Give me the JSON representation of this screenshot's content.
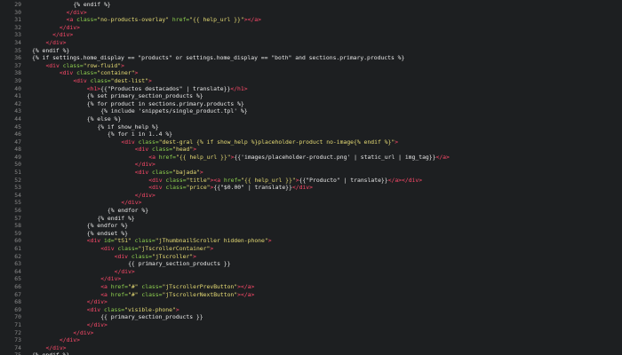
{
  "editor": {
    "colors": {
      "background": "#1d1f21",
      "line_number": "#8a8a8a",
      "tag": "#ff4a6a",
      "attribute": "#8fd14f",
      "string": "#e6db74",
      "template": "#e8e8e8"
    },
    "lines": [
      {
        "num": "29",
        "indent": 12,
        "tokens": [
          {
            "t": "tpl",
            "v": "{% endif %}"
          }
        ]
      },
      {
        "num": "30",
        "indent": 10,
        "tokens": [
          {
            "t": "tag",
            "v": "</div>"
          }
        ]
      },
      {
        "num": "31",
        "indent": 10,
        "tokens": [
          {
            "t": "tag",
            "v": "<a "
          },
          {
            "t": "attr",
            "v": "class="
          },
          {
            "t": "str",
            "v": "\"no-products-overlay\""
          },
          {
            "t": "tpl",
            "v": " "
          },
          {
            "t": "attr",
            "v": "href="
          },
          {
            "t": "str",
            "v": "\"{{ help_url }}\""
          },
          {
            "t": "tag",
            "v": "></a>"
          }
        ]
      },
      {
        "num": "32",
        "indent": 8,
        "tokens": [
          {
            "t": "tag",
            "v": "</div>"
          }
        ]
      },
      {
        "num": "33",
        "indent": 6,
        "tokens": [
          {
            "t": "tag",
            "v": "</div>"
          }
        ]
      },
      {
        "num": "34",
        "indent": 4,
        "tokens": [
          {
            "t": "tag",
            "v": "</div>"
          }
        ]
      },
      {
        "num": "35",
        "indent": 0,
        "tokens": [
          {
            "t": "tpl",
            "v": "{% endif %}"
          }
        ]
      },
      {
        "num": "36",
        "indent": 0,
        "tokens": [
          {
            "t": "tpl",
            "v": "{% if settings.home_display == \"products\" or settings.home_display == \"both\" and sections.primary.products %}"
          }
        ]
      },
      {
        "num": "37",
        "indent": 4,
        "tokens": [
          {
            "t": "tag",
            "v": "<div "
          },
          {
            "t": "attr",
            "v": "class="
          },
          {
            "t": "str",
            "v": "\"row-fluid\""
          },
          {
            "t": "tag",
            "v": ">"
          }
        ]
      },
      {
        "num": "38",
        "indent": 8,
        "tokens": [
          {
            "t": "tag",
            "v": "<div "
          },
          {
            "t": "attr",
            "v": "class="
          },
          {
            "t": "str",
            "v": "\"container\""
          },
          {
            "t": "tag",
            "v": ">"
          }
        ]
      },
      {
        "num": "39",
        "indent": 12,
        "tokens": [
          {
            "t": "tag",
            "v": "<div "
          },
          {
            "t": "attr",
            "v": "class="
          },
          {
            "t": "str",
            "v": "\"dest-list\""
          },
          {
            "t": "tag",
            "v": ">"
          }
        ]
      },
      {
        "num": "40",
        "indent": 16,
        "tokens": [
          {
            "t": "tag",
            "v": "<h1>"
          },
          {
            "t": "tpl",
            "v": "{{\"Productos destacados\" | translate}}"
          },
          {
            "t": "tag",
            "v": "</h1>"
          }
        ]
      },
      {
        "num": "41",
        "indent": 16,
        "tokens": [
          {
            "t": "tpl",
            "v": "{% set primary_section_products %}"
          }
        ]
      },
      {
        "num": "42",
        "indent": 16,
        "tokens": [
          {
            "t": "tpl",
            "v": "{% for product in sections.primary.products %}"
          }
        ]
      },
      {
        "num": "43",
        "indent": 20,
        "tokens": [
          {
            "t": "tpl",
            "v": "{% include 'snippets/single_product.tpl' %}"
          }
        ]
      },
      {
        "num": "44",
        "indent": 16,
        "tokens": [
          {
            "t": "tpl",
            "v": "{% else %}"
          }
        ]
      },
      {
        "num": "45",
        "indent": 19,
        "tokens": [
          {
            "t": "tpl",
            "v": "{% if show_help %}"
          }
        ]
      },
      {
        "num": "46",
        "indent": 22,
        "tokens": [
          {
            "t": "tpl",
            "v": "{% for i in 1..4 %}"
          }
        ]
      },
      {
        "num": "47",
        "indent": 26,
        "tokens": [
          {
            "t": "tag",
            "v": "<div "
          },
          {
            "t": "attr",
            "v": "class="
          },
          {
            "t": "str",
            "v": "\"dest-gral {% if show_help %}placeholder-product no-image{% endif %}\""
          },
          {
            "t": "tag",
            "v": ">"
          }
        ]
      },
      {
        "num": "48",
        "indent": 30,
        "tokens": [
          {
            "t": "tag",
            "v": "<div "
          },
          {
            "t": "attr",
            "v": "class="
          },
          {
            "t": "str",
            "v": "\"head\""
          },
          {
            "t": "tag",
            "v": ">"
          }
        ]
      },
      {
        "num": "49",
        "indent": 34,
        "tokens": [
          {
            "t": "tag",
            "v": "<a "
          },
          {
            "t": "attr",
            "v": "href="
          },
          {
            "t": "str",
            "v": "\"{{ help_url }}\""
          },
          {
            "t": "tag",
            "v": ">"
          },
          {
            "t": "tpl",
            "v": "{{'images/placeholder-product.png' | static_url | img_tag}}"
          },
          {
            "t": "tag",
            "v": "</a>"
          }
        ]
      },
      {
        "num": "50",
        "indent": 30,
        "tokens": [
          {
            "t": "tag",
            "v": "</div>"
          }
        ]
      },
      {
        "num": "51",
        "indent": 30,
        "tokens": [
          {
            "t": "tag",
            "v": "<div "
          },
          {
            "t": "attr",
            "v": "class="
          },
          {
            "t": "str",
            "v": "\"bajada\""
          },
          {
            "t": "tag",
            "v": ">"
          }
        ]
      },
      {
        "num": "52",
        "indent": 34,
        "tokens": [
          {
            "t": "tag",
            "v": "<div "
          },
          {
            "t": "attr",
            "v": "class="
          },
          {
            "t": "str",
            "v": "\"title\""
          },
          {
            "t": "tag",
            "v": "><a "
          },
          {
            "t": "attr",
            "v": "href="
          },
          {
            "t": "str",
            "v": "\"{{ help_url }}\""
          },
          {
            "t": "tag",
            "v": ">"
          },
          {
            "t": "tpl",
            "v": "{{\"Producto\" | translate}}"
          },
          {
            "t": "tag",
            "v": "</a></div>"
          }
        ]
      },
      {
        "num": "53",
        "indent": 34,
        "tokens": [
          {
            "t": "tag",
            "v": "<div "
          },
          {
            "t": "attr",
            "v": "class="
          },
          {
            "t": "str",
            "v": "\"price\""
          },
          {
            "t": "tag",
            "v": ">"
          },
          {
            "t": "tpl",
            "v": "{{\"$0.00\" | translate}}"
          },
          {
            "t": "tag",
            "v": "</div>"
          }
        ]
      },
      {
        "num": "54",
        "indent": 30,
        "tokens": [
          {
            "t": "tag",
            "v": "</div>"
          }
        ]
      },
      {
        "num": "55",
        "indent": 26,
        "tokens": [
          {
            "t": "tag",
            "v": "</div>"
          }
        ]
      },
      {
        "num": "56",
        "indent": 22,
        "tokens": [
          {
            "t": "tpl",
            "v": "{% endfor %}"
          }
        ]
      },
      {
        "num": "57",
        "indent": 19,
        "tokens": [
          {
            "t": "tpl",
            "v": "{% endif %}"
          }
        ]
      },
      {
        "num": "58",
        "indent": 16,
        "tokens": [
          {
            "t": "tpl",
            "v": "{% endfor %}"
          }
        ]
      },
      {
        "num": "59",
        "indent": 16,
        "tokens": [
          {
            "t": "tpl",
            "v": "{% endset %}"
          }
        ]
      },
      {
        "num": "60",
        "indent": 16,
        "tokens": [
          {
            "t": "tag",
            "v": "<div "
          },
          {
            "t": "attr",
            "v": "id="
          },
          {
            "t": "str",
            "v": "\"tS1\""
          },
          {
            "t": "tpl",
            "v": " "
          },
          {
            "t": "attr",
            "v": "class="
          },
          {
            "t": "str",
            "v": "\"jThumbnailScroller hidden-phone\""
          },
          {
            "t": "tag",
            "v": ">"
          }
        ]
      },
      {
        "num": "61",
        "indent": 20,
        "tokens": [
          {
            "t": "tag",
            "v": "<div "
          },
          {
            "t": "attr",
            "v": "class="
          },
          {
            "t": "str",
            "v": "\"jTscrollerContainer\""
          },
          {
            "t": "tag",
            "v": ">"
          }
        ]
      },
      {
        "num": "62",
        "indent": 24,
        "tokens": [
          {
            "t": "tag",
            "v": "<div "
          },
          {
            "t": "attr",
            "v": "class="
          },
          {
            "t": "str",
            "v": "\"jTscroller\""
          },
          {
            "t": "tag",
            "v": ">"
          }
        ]
      },
      {
        "num": "63",
        "indent": 28,
        "tokens": [
          {
            "t": "tpl",
            "v": "{{ primary_section_products }}"
          }
        ]
      },
      {
        "num": "64",
        "indent": 24,
        "tokens": [
          {
            "t": "tag",
            "v": "</div>"
          }
        ]
      },
      {
        "num": "65",
        "indent": 20,
        "tokens": [
          {
            "t": "tag",
            "v": "</div>"
          }
        ]
      },
      {
        "num": "66",
        "indent": 20,
        "tokens": [
          {
            "t": "tag",
            "v": "<a "
          },
          {
            "t": "attr",
            "v": "href="
          },
          {
            "t": "str",
            "v": "\"#\""
          },
          {
            "t": "tpl",
            "v": " "
          },
          {
            "t": "attr",
            "v": "class="
          },
          {
            "t": "str",
            "v": "\"jTscrollerPrevButton\""
          },
          {
            "t": "tag",
            "v": "></a>"
          }
        ]
      },
      {
        "num": "67",
        "indent": 20,
        "tokens": [
          {
            "t": "tag",
            "v": "<a "
          },
          {
            "t": "attr",
            "v": "href="
          },
          {
            "t": "str",
            "v": "\"#\""
          },
          {
            "t": "tpl",
            "v": " "
          },
          {
            "t": "attr",
            "v": "class="
          },
          {
            "t": "str",
            "v": "\"jTscrollerNextButton\""
          },
          {
            "t": "tag",
            "v": "></a>"
          }
        ]
      },
      {
        "num": "68",
        "indent": 16,
        "tokens": [
          {
            "t": "tag",
            "v": "</div>"
          }
        ]
      },
      {
        "num": "69",
        "indent": 16,
        "tokens": [
          {
            "t": "tag",
            "v": "<div "
          },
          {
            "t": "attr",
            "v": "class="
          },
          {
            "t": "str",
            "v": "\"visible-phone\""
          },
          {
            "t": "tag",
            "v": ">"
          }
        ]
      },
      {
        "num": "70",
        "indent": 20,
        "tokens": [
          {
            "t": "tpl",
            "v": "{{ primary_section_products }}"
          }
        ]
      },
      {
        "num": "71",
        "indent": 16,
        "tokens": [
          {
            "t": "tag",
            "v": "</div>"
          }
        ]
      },
      {
        "num": "72",
        "indent": 12,
        "tokens": [
          {
            "t": "tag",
            "v": "</div>"
          }
        ]
      },
      {
        "num": "73",
        "indent": 8,
        "tokens": [
          {
            "t": "tag",
            "v": "</div>"
          }
        ]
      },
      {
        "num": "74",
        "indent": 4,
        "tokens": [
          {
            "t": "tag",
            "v": "</div>"
          }
        ]
      },
      {
        "num": "75",
        "indent": 0,
        "tokens": [
          {
            "t": "tpl",
            "v": "{% endif %}"
          }
        ]
      },
      {
        "num": "76",
        "indent": 0,
        "tokens": []
      }
    ]
  }
}
